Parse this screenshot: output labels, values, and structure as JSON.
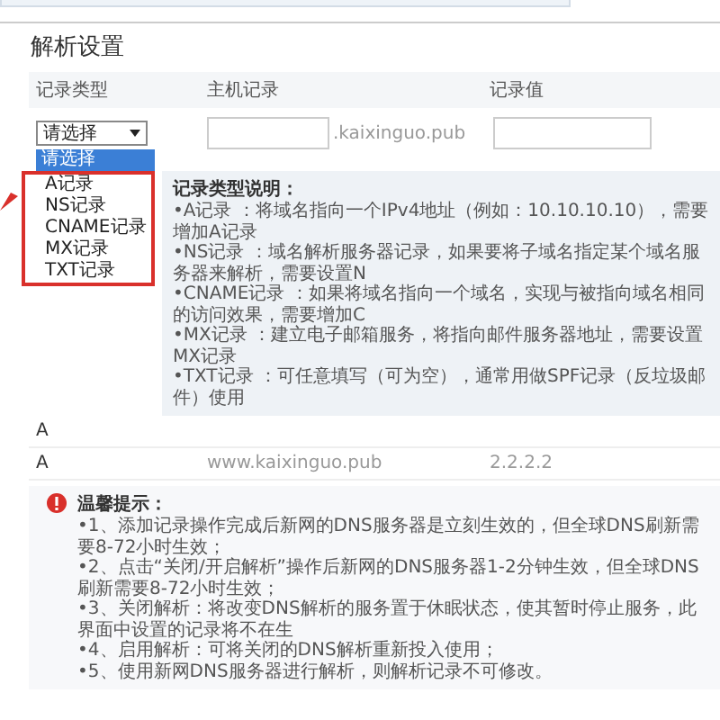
{
  "section_title": "解析设置",
  "table": {
    "columns": [
      "记录类型",
      "主机记录",
      "记录值"
    ]
  },
  "form": {
    "record_type": {
      "value": "请选择",
      "options": [
        {
          "label": "请选择",
          "selected": true
        },
        {
          "label": "A记录",
          "selected": false
        },
        {
          "label": "NS记录",
          "selected": false
        },
        {
          "label": "CNAME记录",
          "selected": false
        },
        {
          "label": "MX记录",
          "selected": false
        },
        {
          "label": "TXT记录",
          "selected": false
        }
      ]
    },
    "domain_suffix": ".kaixinguo.pub"
  },
  "type_help": {
    "title": "记录类型说明：",
    "lines": [
      "•A记录 ：将域名指向一个IPv4地址（例如：10.10.10.10），需要增加A记录",
      "•NS记录 ：域名解析服务器记录，如果要将子域名指定某个域名服务器来解析，需要设置N",
      "•CNAME记录 ：如果将域名指向一个域名，实现与被指向域名相同的访问效果，需要增加C",
      "•MX记录 ：建立电子邮箱服务，将指向邮件服务器地址，需要设置MX记录",
      "•TXT记录 ：可任意填写（可为空），通常用做SPF记录（反垃圾邮件）使用"
    ]
  },
  "rows": [
    {
      "type": "A"
    },
    {
      "type": "A",
      "host": "www.kaixinguo.pub",
      "value": "2.2.2.2"
    }
  ],
  "tips": {
    "title": "温馨提示：",
    "lines": [
      "•1、添加记录操作完成后新网的DNS服务器是立刻生效的，但全球DNS刷新需要8-72小时生效；",
      "•2、点击“关闭/开启解析”操作后新网的DNS服务器1-2分钟生效，但全球DNS刷新需要8-72小时生效；",
      "•3、关闭解析：将改变DNS解析的服务置于休眠状态，使其暂时停止服务，此界面中设置的记录将不在生",
      "•4、启用解析：可将关闭的DNS解析重新投入使用；",
      "•5、使用新网DNS服务器进行解析，则解析记录不可修改。"
    ]
  }
}
